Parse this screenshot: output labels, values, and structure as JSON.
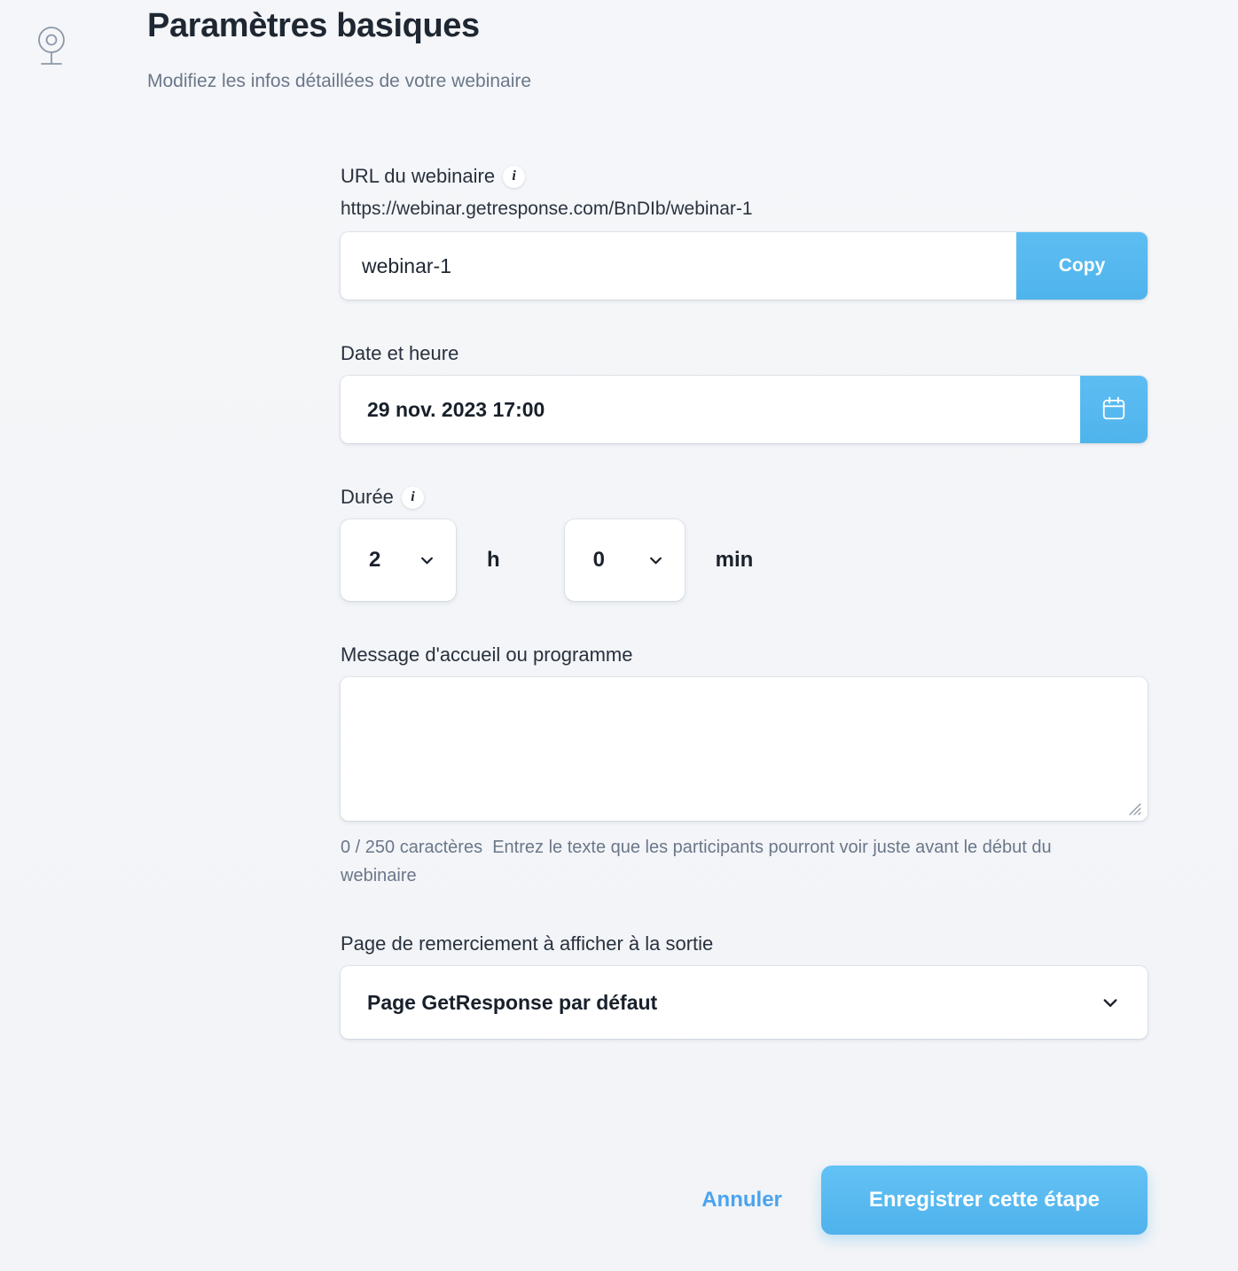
{
  "header": {
    "icon": "webcam-icon",
    "title": "Paramètres basiques",
    "subtitle": "Modifiez les infos détaillées de votre webinaire"
  },
  "form": {
    "url": {
      "label": "URL du webinaire",
      "info_icon": "info-icon",
      "preview": "https://webinar.getresponse.com/BnDIb/webinar-1",
      "value": "webinar-1",
      "placeholder": "webinar-1",
      "copy_label": "Copy"
    },
    "datetime": {
      "label": "Date et heure",
      "value": "29 nov. 2023 17:00",
      "calendar_icon": "calendar-icon"
    },
    "duration": {
      "label": "Durée",
      "info_icon": "info-icon",
      "hours_value": "2",
      "hours_unit": "h",
      "minutes_value": "0",
      "minutes_unit": "min",
      "chevron_icon": "chevron-down-icon"
    },
    "message": {
      "label": "Message d'accueil ou programme",
      "value": "",
      "placeholder": "",
      "counter": "0 / 250 caractères",
      "hint": "Entrez le texte que les participants pourront voir juste avant le début du webinaire"
    },
    "thank_you_page": {
      "label": "Page de remerciement à afficher à la sortie",
      "value": "Page GetResponse par défaut",
      "chevron_icon": "chevron-down-icon"
    }
  },
  "footer": {
    "cancel_label": "Annuler",
    "save_label": "Enregistrer cette étape"
  },
  "colors": {
    "background": "#f3f5f8",
    "accent_blue": "#54b9ef",
    "link_blue": "#4aa3ee",
    "text_dark": "#1e2732",
    "text_muted": "#6b7789"
  }
}
